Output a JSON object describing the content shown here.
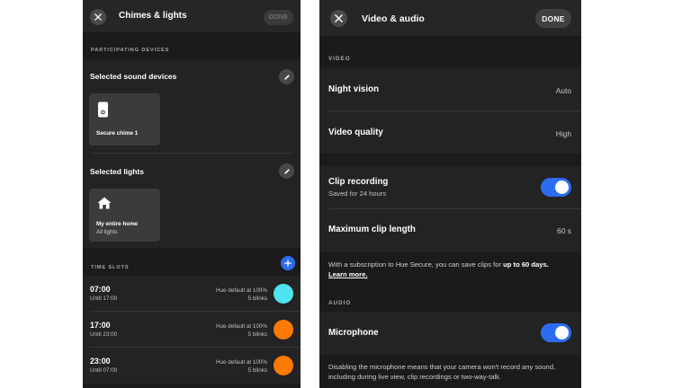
{
  "chimes": {
    "header": {
      "title": "Chimes & lights",
      "done_label": "DONE"
    },
    "participating_label": "PARTICIPATING DEVICES",
    "sound_devices": {
      "title": "Selected sound devices",
      "tile": {
        "icon": "chime-device-icon",
        "name": "Secure chime 1"
      }
    },
    "lights": {
      "title": "Selected lights",
      "tile": {
        "icon": "home-icon",
        "name": "My entire home",
        "sub": "All lights"
      }
    },
    "time_slots_label": "TIME SLOTS",
    "slots": [
      {
        "time": "07:00",
        "until": "Until 17:00",
        "hue": "Hue default at 100%",
        "blinks": "5 blinks",
        "color": "#4fe3f0"
      },
      {
        "time": "17:00",
        "until": "Until 23:00",
        "hue": "Hue default at 100%",
        "blinks": "5 blinks",
        "color": "#ff7a00"
      },
      {
        "time": "23:00",
        "until": "Until 07:00",
        "hue": "Hue default at 100%",
        "blinks": "5 blinks",
        "color": "#ff7a00"
      }
    ]
  },
  "video": {
    "header": {
      "title": "Video & audio",
      "done_label": "DONE"
    },
    "video_section": "VIDEO",
    "night_vision": {
      "label": "Night vision",
      "value": "Auto"
    },
    "video_quality": {
      "label": "Video quality",
      "value": "High"
    },
    "clip_recording": {
      "label": "Clip recording",
      "sub": "Saved for 24 hours",
      "enabled": true
    },
    "max_clip_length": {
      "label": "Maximum clip length",
      "value": "60 s"
    },
    "subscription_note": {
      "text": "With a subscription to Hue Secure, you can save clips for ",
      "bold": "up to 60 days.",
      "link": "Learn more."
    },
    "audio_section": "AUDIO",
    "microphone": {
      "label": "Microphone",
      "enabled": true
    },
    "microphone_note": "Disabling the microphone means that your camera won't record any sound, including during live view, clip recordings or two-way-talk."
  },
  "colors": {
    "accent": "#2d6cf0",
    "background": "#1b1b1b",
    "cyan_slot": "#4fe3f0",
    "orange_slot": "#ff7a00"
  }
}
